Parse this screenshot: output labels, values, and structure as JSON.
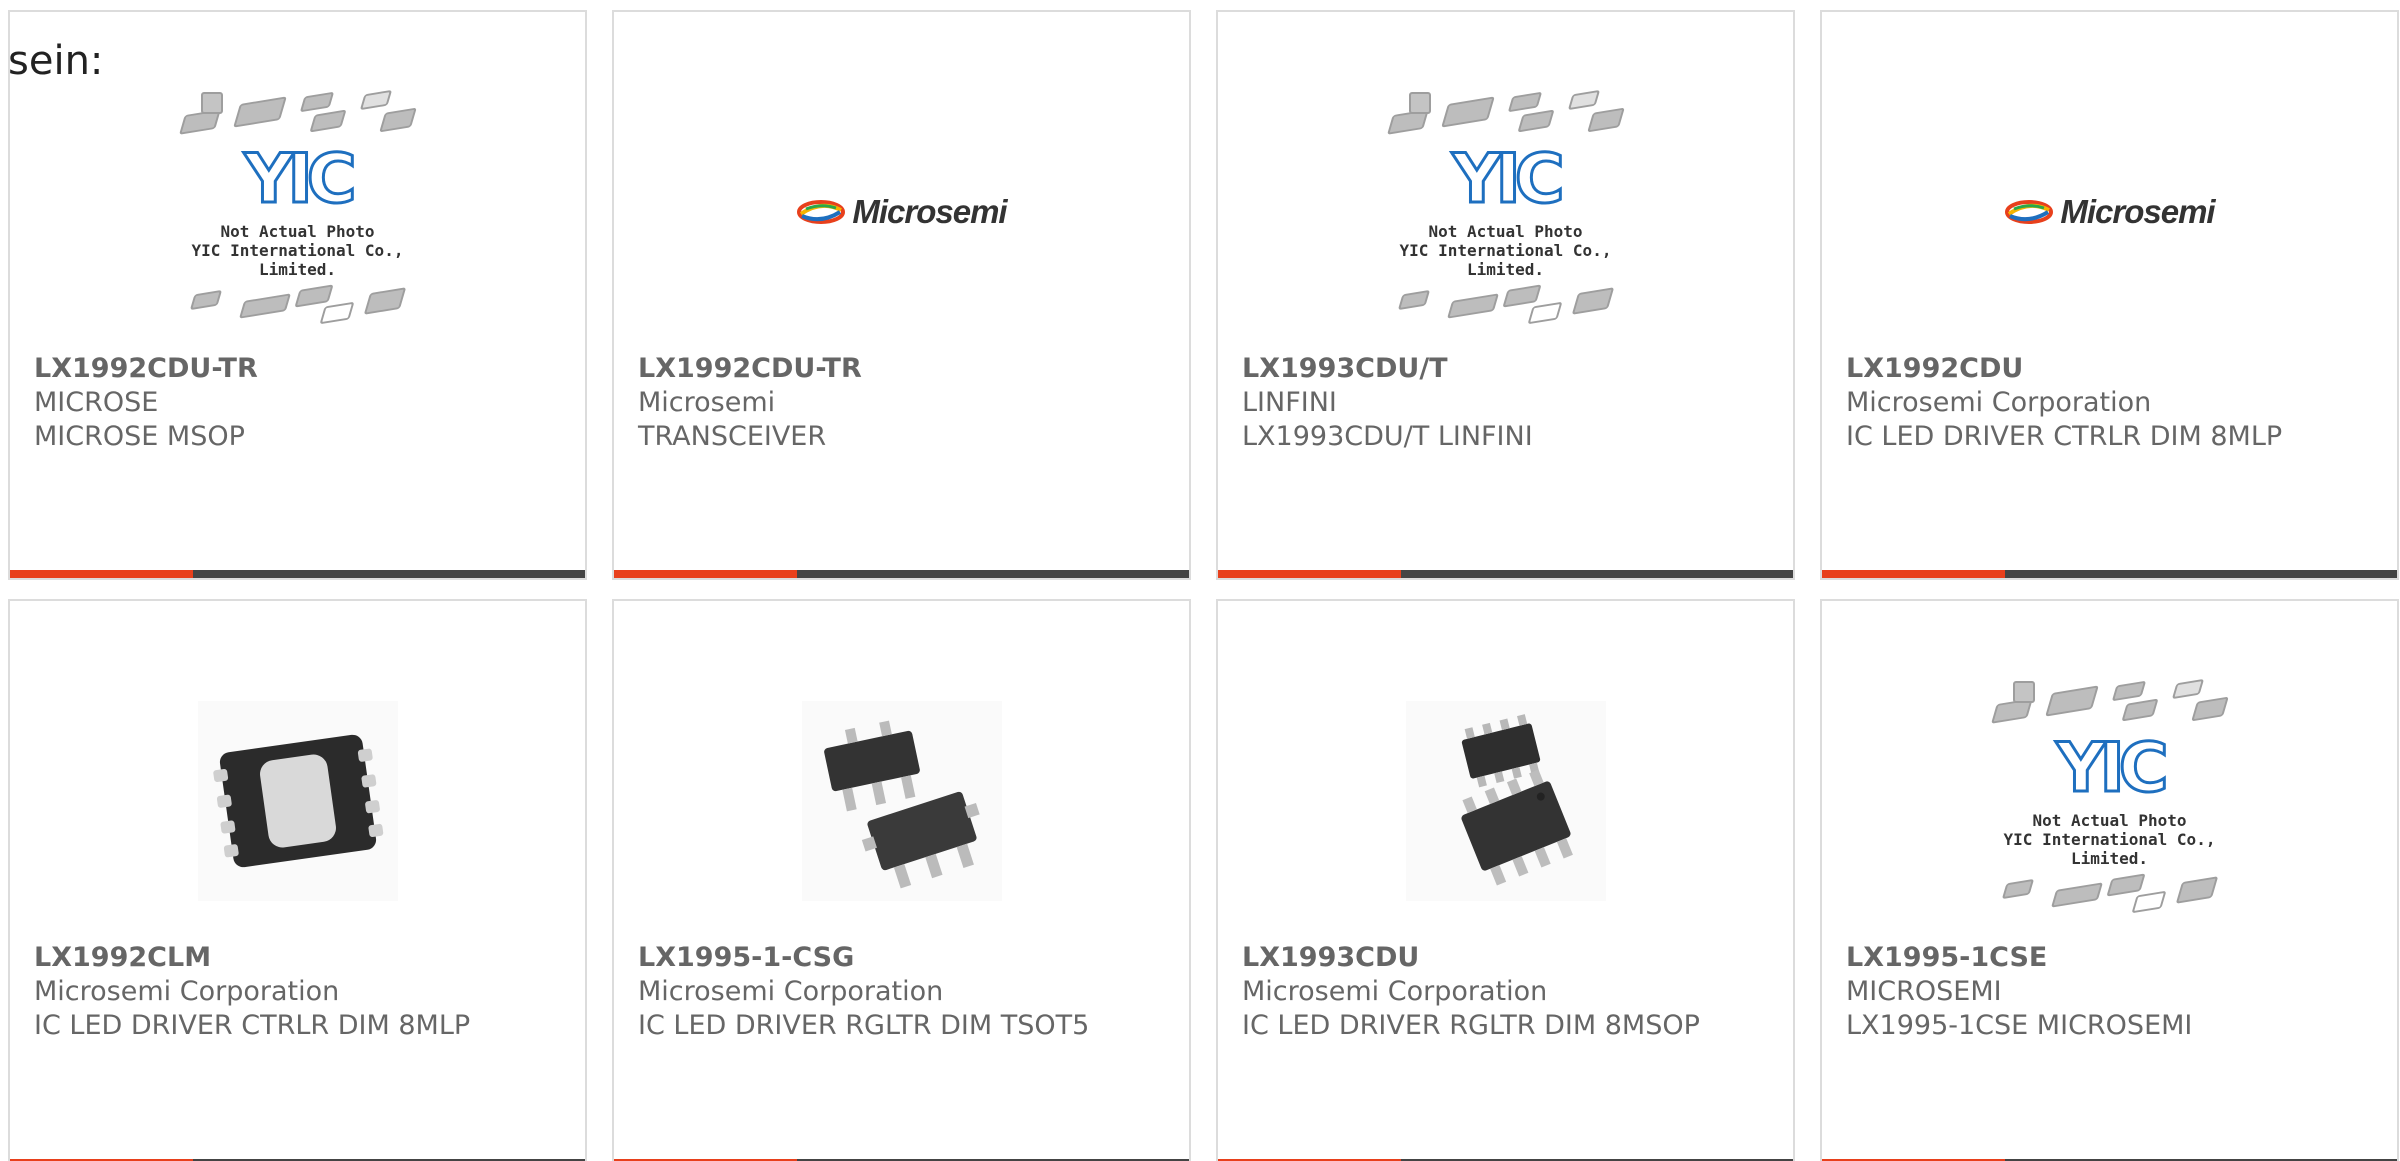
{
  "lead_text": "sein:",
  "placeholder": {
    "logo_text": "YIC",
    "caption_line1": "Not Actual Photo",
    "caption_line2": "YIC International Co., Limited."
  },
  "brand_logo_text": "Microsemi",
  "colors": {
    "accent": "#e8401c",
    "bar": "#444444",
    "text": "#666666",
    "border": "#dcdcdc"
  },
  "products": [
    {
      "part": "LX1992CDU-TR",
      "manufacturer": "MICROSE",
      "description": "MICROSE MSOP",
      "image": "yic-placeholder"
    },
    {
      "part": "LX1992CDU-TR",
      "manufacturer": "Microsemi",
      "description": "TRANSCEIVER",
      "image": "microsemi-logo"
    },
    {
      "part": "LX1993CDU/T",
      "manufacturer": "LINFINI",
      "description": "LX1993CDU/T LINFINI",
      "image": "yic-placeholder"
    },
    {
      "part": "LX1992CDU",
      "manufacturer": "Microsemi Corporation",
      "description": "IC LED DRIVER CTRLR DIM 8MLP",
      "image": "microsemi-logo"
    },
    {
      "part": "LX1992CLM",
      "manufacturer": "Microsemi Corporation",
      "description": "IC LED DRIVER CTRLR DIM 8MLP",
      "image": "mlp-package-photo"
    },
    {
      "part": "LX1995-1-CSG",
      "manufacturer": "Microsemi Corporation",
      "description": "IC LED DRIVER RGLTR DIM TSOT5",
      "image": "tsot-package-photo"
    },
    {
      "part": "LX1993CDU",
      "manufacturer": "Microsemi Corporation",
      "description": "IC LED DRIVER RGLTR DIM 8MSOP",
      "image": "msop-package-photo"
    },
    {
      "part": "LX1995-1CSE",
      "manufacturer": "MICROSEMI",
      "description": "LX1995-1CSE MICROSEMI",
      "image": "yic-placeholder"
    }
  ]
}
